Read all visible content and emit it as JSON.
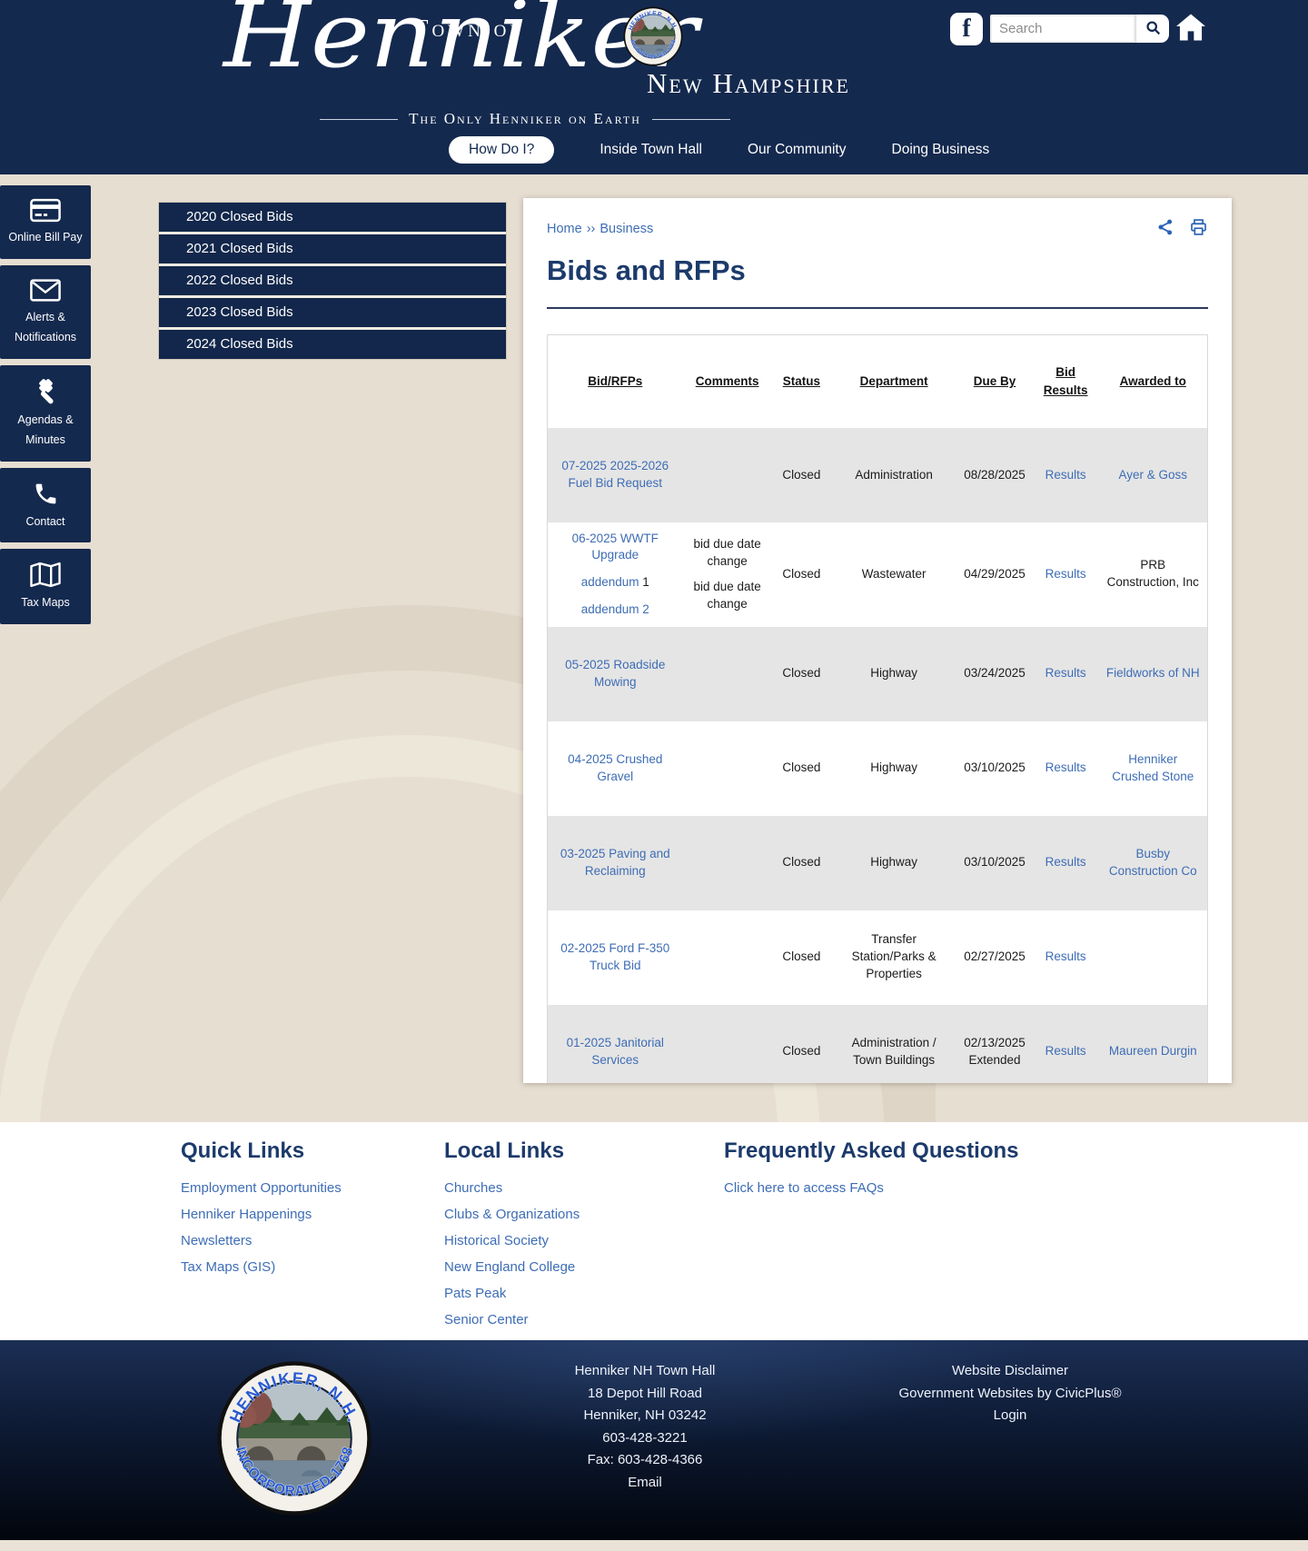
{
  "header": {
    "town_of": "Town of",
    "town_name": "Henniker",
    "state": "New Hampshire",
    "tagline": "The Only Henniker on Earth",
    "search": {
      "placeholder": "Search"
    },
    "nav_items": [
      {
        "label": "How Do I?",
        "active": true
      },
      {
        "label": "Inside Town Hall",
        "active": false
      },
      {
        "label": "Our Community",
        "active": false
      },
      {
        "label": "Doing Business",
        "active": false
      }
    ]
  },
  "seal": {
    "arc_top": "HENNIKER, N.H.",
    "arc_bottom": "INCORPORATED-1768"
  },
  "quick_rail": [
    {
      "icon": "credit-card-icon",
      "label": "Online Bill Pay"
    },
    {
      "icon": "envelope-icon",
      "label": "Alerts & Notifications"
    },
    {
      "icon": "gavel-icon",
      "label": "Agendas & Minutes"
    },
    {
      "icon": "phone-icon",
      "label": "Contact"
    },
    {
      "icon": "map-icon",
      "label": "Tax Maps"
    }
  ],
  "side_menu": [
    "2020 Closed Bids",
    "2021 Closed Bids",
    "2022 Closed Bids",
    "2023 Closed Bids",
    "2024 Closed Bids"
  ],
  "content": {
    "breadcrumb": {
      "home": "Home",
      "separator": "››",
      "current": "Business"
    },
    "title": "Bids and RFPs",
    "table": {
      "headers": [
        "Bid/RFPs",
        "Comments",
        "Status",
        "Department",
        "Due By",
        "Bid Results",
        "Awarded to"
      ],
      "rows": [
        {
          "bid_links": [
            {
              "text": "07-2025 2025-2026 Fuel Bid Request"
            }
          ],
          "comments": [],
          "status": "Closed",
          "department": "Administration",
          "due_by": "08/28/2025",
          "bid_results": "Results",
          "awarded_to": "Ayer & Goss",
          "awarded_link": true
        },
        {
          "bid_links": [
            {
              "text": "06-2025 WWTF Upgrade"
            },
            {
              "text": "addendum",
              "plain": " 1"
            },
            {
              "text": "addendum 2"
            }
          ],
          "comments": [
            "bid due date change",
            "bid due date change"
          ],
          "status": "Closed",
          "department": "Wastewater",
          "due_by": "04/29/2025",
          "bid_results": "Results",
          "awarded_to": "PRB Construction, Inc",
          "awarded_link": false
        },
        {
          "bid_links": [
            {
              "text": "05-2025 Roadside Mowing"
            }
          ],
          "comments": [],
          "status": "Closed",
          "department": "Highway",
          "due_by": "03/24/2025",
          "bid_results": "Results",
          "awarded_to": "Fieldworks of NH",
          "awarded_link": true
        },
        {
          "bid_links": [
            {
              "text": "04-2025 Crushed Gravel"
            }
          ],
          "comments": [],
          "status": "Closed",
          "department": "Highway",
          "due_by": "03/10/2025",
          "bid_results": "Results",
          "awarded_to": "Henniker Crushed Stone",
          "awarded_link": true
        },
        {
          "bid_links": [
            {
              "text": "03-2025 Paving and Reclaiming"
            }
          ],
          "comments": [],
          "status": "Closed",
          "department": "Highway",
          "due_by": "03/10/2025",
          "bid_results": "Results",
          "awarded_to": "Busby Construction Co",
          "awarded_link": true
        },
        {
          "bid_links": [
            {
              "text": "02-2025 Ford F-350 Truck Bid"
            }
          ],
          "comments": [],
          "status": "Closed",
          "department": "Transfer Station/Parks & Properties",
          "due_by": "02/27/2025",
          "bid_results": "Results",
          "awarded_to": "",
          "awarded_link": false
        },
        {
          "bid_links": [
            {
              "text": "01-2025 Janitorial Services"
            }
          ],
          "comments": [],
          "status": "Closed",
          "department": "Administration / Town Buildings",
          "due_by": "02/13/2025 Extended",
          "bid_results": "Results",
          "awarded_to": "Maureen Durgin",
          "awarded_link": true
        }
      ]
    }
  },
  "links_section": {
    "quick_links": {
      "heading": "Quick Links",
      "links": [
        "Employment Opportunities",
        "Henniker Happenings",
        "Newsletters",
        "Tax Maps (GIS)"
      ]
    },
    "local_links": {
      "heading": "Local Links",
      "links": [
        "Churches",
        "Clubs & Organizations",
        "Historical Society",
        "New England College",
        "Pats Peak",
        "Senior Center"
      ]
    },
    "faq": {
      "heading": "Frequently Asked Questions",
      "links": [
        "Click here to access FAQs"
      ]
    }
  },
  "footer": {
    "address": [
      "Henniker NH Town Hall",
      "18 Depot Hill Road",
      "Henniker, NH 03242",
      "603-428-3221",
      "Fax: 603-428-4366"
    ],
    "email_label": "Email",
    "right_links": [
      "Website Disclaimer",
      "Government Websites by CivicPlus®",
      "Login"
    ]
  },
  "colors": {
    "navy": "#14294e",
    "beige": "#e7ded2",
    "link_blue": "#3e6db5",
    "heading_navy": "#1c3a6b"
  }
}
